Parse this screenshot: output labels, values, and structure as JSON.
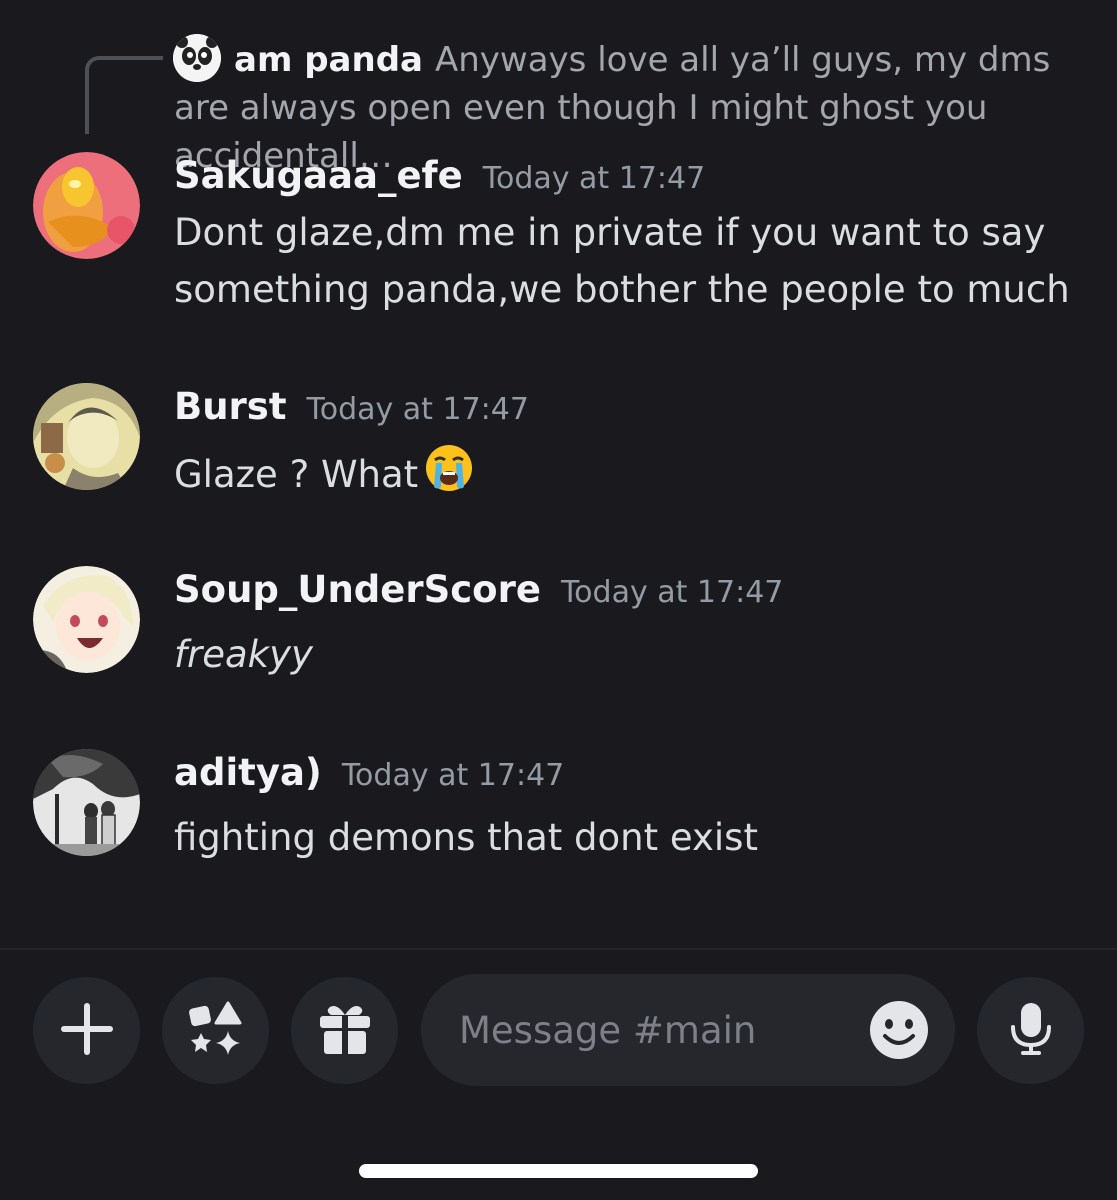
{
  "reply": {
    "author": "am panda",
    "text": "Anyways love all ya’ll guys, my dms are always open even though I might ghost you accidentall…"
  },
  "messages": [
    {
      "username": "Sakugaaa_efe",
      "timestamp": "Today at 17:47",
      "content": "Dont glaze,dm me in private if you want to say something panda,we bother the people to much"
    },
    {
      "username": "Burst",
      "timestamp": "Today at 17:47",
      "content": "Glaze ? What",
      "emoji": "loudly-crying-face"
    },
    {
      "username": "Soup_UnderScore",
      "timestamp": "Today at 17:47",
      "content": "freakyy",
      "italic": true
    },
    {
      "username": "aditya)",
      "timestamp": "Today at 17:47",
      "content": "fighting demons that dont exist"
    }
  ],
  "composer": {
    "placeholder": "Message #main",
    "buttons": [
      "plus-icon",
      "apps-icon",
      "gift-icon",
      "emoji-icon",
      "microphone-icon"
    ]
  },
  "colors": {
    "background": "#1a1a1e",
    "username": "#f2f3f5",
    "timestamp": "#949ba4",
    "text": "#dbdee1",
    "input_bg": "#26272c"
  }
}
